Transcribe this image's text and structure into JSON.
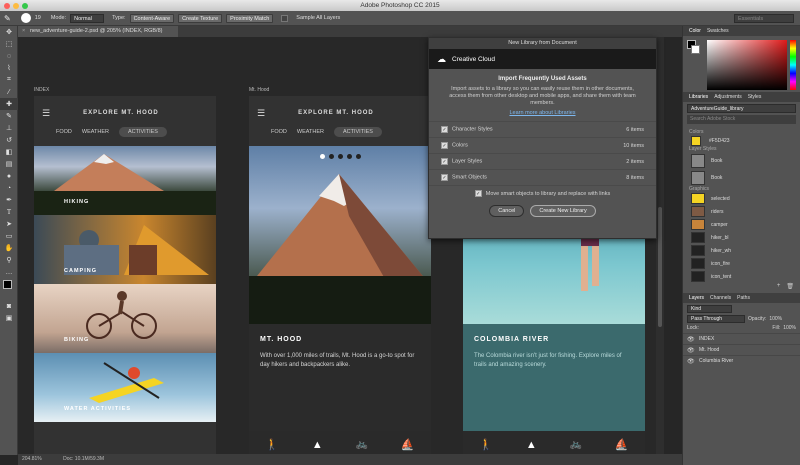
{
  "app": {
    "title": "Adobe Photoshop CC 2015"
  },
  "options": {
    "mode_label": "Mode:",
    "mode_value": "Normal",
    "type_label": "Type:",
    "type_content_aware": "Content-Aware",
    "type_create_texture": "Create Texture",
    "type_proximity": "Proximity Match",
    "sample_all_layers": "Sample All Layers",
    "brush_size": "19",
    "workspace": "Essentials"
  },
  "document": {
    "tab_title": "new_adventure-guide-2.psd @ 205% (INDEX, RGB/8)",
    "zoom": "204.81%",
    "doc_info": "Doc: 10.1M/59.3M"
  },
  "artboards": {
    "index": {
      "label": "INDEX",
      "nav_title": "EXPLORE MT. HOOD",
      "tabs": [
        "FOOD",
        "WEATHER",
        "ACTIVITIES"
      ],
      "tiles": [
        "HIKING",
        "CAMPING",
        "BIKING",
        "WATER ACTIVITIES"
      ]
    },
    "mthood": {
      "label": "Mt. Hood",
      "nav_title": "EXPLORE MT. HOOD",
      "tabs": [
        "FOOD",
        "WEATHER",
        "ACTIVITIES"
      ],
      "heading": "MT. HOOD",
      "body": "With over 1,000 miles of trails, Mt. Hood is a go-to spot for day hikers and backpackers alike."
    },
    "columbia": {
      "heading": "COLOMBIA RIVER",
      "body": "The Colombia river isn't just for fishing. Explore miles of trails and amazing scenery."
    }
  },
  "dialog": {
    "title": "New Library from Document",
    "brand": "Creative Cloud",
    "heading": "Import Frequently Used Assets",
    "description": "Import assets to a library so you can easily reuse them in other documents, access them from other desktop and mobile apps, and share them with team members.",
    "learn_more": "Learn more about Libraries",
    "rows": [
      {
        "label": "Character Styles",
        "count": "6 items"
      },
      {
        "label": "Colors",
        "count": "10 items"
      },
      {
        "label": "Layer Styles",
        "count": "2 items"
      },
      {
        "label": "Smart Objects",
        "count": "8 items"
      }
    ],
    "move_label": "Move smart objects to library and replace with links",
    "cancel": "Cancel",
    "create": "Create New Library"
  },
  "panels": {
    "color_tabs": [
      "Color",
      "Swatches"
    ],
    "lib_tabs": [
      "Libraries",
      "Adjustments",
      "Styles"
    ],
    "library_name": "AdventureGuide_library",
    "search_placeholder": "Search Adobe Stock",
    "sections": {
      "colors": "Colors",
      "colors_value": "#F5D423",
      "layer_styles": "Layer Styles",
      "graphics": "Graphics"
    },
    "layer_style_items": [
      "Book",
      "Book"
    ],
    "graphics_items": [
      "selected",
      "riders",
      "camper",
      "hiker_bl",
      "hiker_wh",
      "icon_fire",
      "icon_tent"
    ],
    "layer_tabs": [
      "Layers",
      "Channels",
      "Paths"
    ],
    "kind": "Kind",
    "blend_mode": "Pass Through",
    "opacity_label": "Opacity:",
    "opacity": "100%",
    "lock_label": "Lock:",
    "fill_label": "Fill:",
    "fill": "100%",
    "layers": [
      "INDEX",
      "Mt. Hood",
      "Columbia River"
    ]
  },
  "colors": {
    "accent_yellow": "#F5D423",
    "cc_blue": "#2d8ceb"
  }
}
